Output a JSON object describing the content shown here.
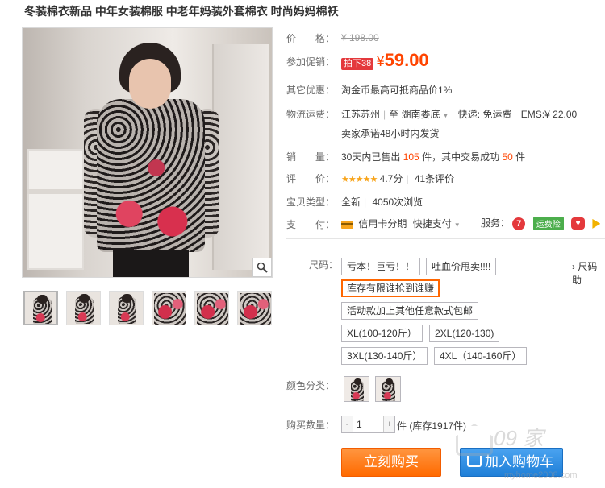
{
  "product": {
    "title": "冬装棉衣新品 中年女装棉服 中老年妈装外套棉衣 时尚妈妈棉袄"
  },
  "price": {
    "label": "价　　格：",
    "original": "¥ 198.00",
    "promo_label": "参加促销：",
    "promo_tag": "拍下38",
    "currency": "¥",
    "promo_price": "59.00"
  },
  "other_discount": {
    "label": "其它优惠：",
    "text": "淘金币最高可抵商品价1%"
  },
  "logistics": {
    "label": "物流运费：",
    "from": "江苏苏州",
    "to": "湖南娄底",
    "express": "快递: 免运费",
    "ems": "EMS:¥ 22.00",
    "ship_promise": "卖家承诺48小时内发货"
  },
  "sales": {
    "label": "销　　量：",
    "prefix": "30天内已售出",
    "sold": "105",
    "middle": "件，其中交易成功",
    "success": "50",
    "suffix": "件"
  },
  "rating": {
    "label": "评　　价：",
    "stars": "★★★★★",
    "score": "4.7分",
    "reviews": "41条评价"
  },
  "item_type": {
    "label": "宝贝类型：",
    "condition": "全新",
    "views": "4050次浏览"
  },
  "payment": {
    "label": "支　　付：",
    "installment": "信用卡分期",
    "quick_pay": "快捷支付",
    "service_label": "服务：",
    "service_7": "7",
    "service_ins": "运费险"
  },
  "size": {
    "label": "尺码：",
    "options": [
      "亏本！巨亏！！",
      "吐血价甩卖!!!!",
      "库存有限谁抢到谁赚",
      "活动款加上其他任意款式包邮",
      "XL(100-120斤）",
      "2XL(120-130)",
      "3XL(130-140斤）",
      "4XL（140-160斤）"
    ],
    "more": "› 尺码助"
  },
  "color": {
    "label": "颜色分类："
  },
  "quantity": {
    "label": "购买数量：",
    "minus": "-",
    "value": "1",
    "plus": "+",
    "unit": "件",
    "stock": "(库存1917件)"
  },
  "actions": {
    "buy_now": "立刻购买",
    "add_to_cart": "加入购物车"
  },
  "watermark": {
    "brand": "09 家",
    "url": "myhome2008.com"
  },
  "colors": {
    "accent": "#ff4400",
    "buy_button": "#ff6a00",
    "cart_button": "#1f7fd8",
    "selected_border": "#ff6600"
  }
}
